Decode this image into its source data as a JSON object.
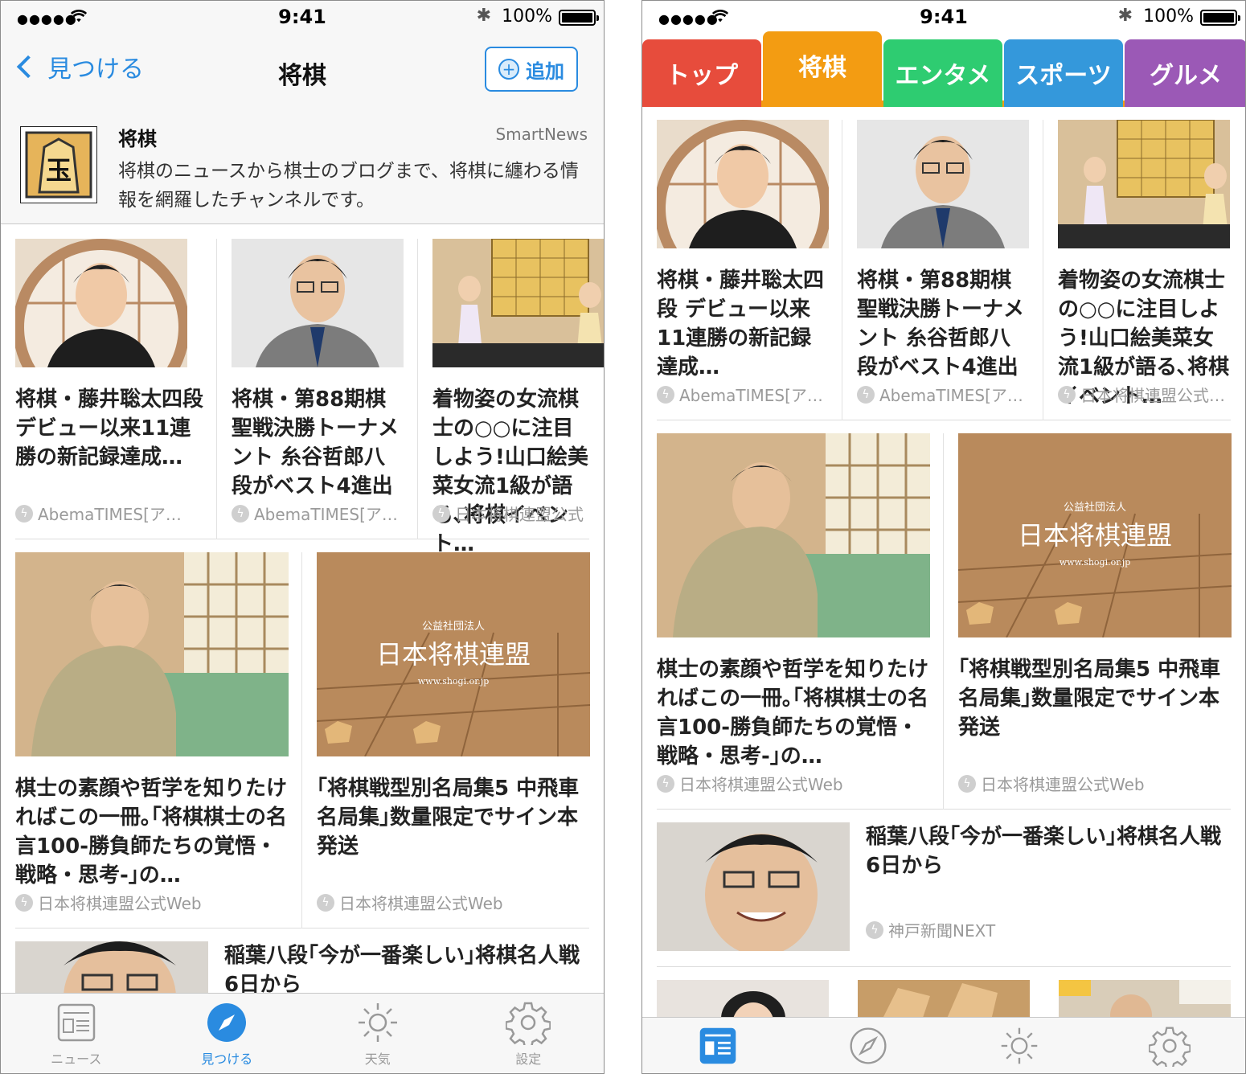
{
  "status": {
    "signal": "●●●●●",
    "time": "9:41",
    "bluetooth": "✱",
    "battery": "100%"
  },
  "left": {
    "nav": {
      "back_label": "見つける",
      "title": "将棋",
      "add_label": "追加"
    },
    "channel": {
      "name": "将棋",
      "source": "SmartNews",
      "description": "将棋のニュースから棋士のブログまで、将棋に纏わる情報を網羅したチャンネルです。",
      "logo_char": "玉"
    },
    "articles_row1": [
      {
        "title": "将棋・藤井聡太四段 デビュー以来11連勝の新記録達成…",
        "source": "AbemaTIMES[ア…"
      },
      {
        "title": "将棋・第88期棋聖戦決勝トーナメント 糸谷哲郎八段がベスト4進出",
        "source": "AbemaTIMES[ア…"
      },
      {
        "title": "着物姿の女流棋士の○○に注目しよう!山口絵美菜女流1級が語る､将棋イベント…",
        "source": "日本将棋連盟公式…"
      }
    ],
    "articles_row2": [
      {
        "title": "棋士の素顔や哲学を知りたければこの一冊｡｢将棋棋士の名言100-勝負師たちの覚悟・戦略・思考-｣の…",
        "source": "日本将棋連盟公式Web"
      },
      {
        "title": "｢将棋戦型別名局集5 中飛車名局集｣数量限定でサイン本発送",
        "source": "日本将棋連盟公式Web"
      }
    ],
    "article_wide": {
      "title": "稲葉八段｢今が一番楽しい｣将棋名人戦6日から"
    },
    "tabbar": [
      "ニュース",
      "見つける",
      "天気",
      "設定"
    ]
  },
  "right": {
    "tabs": [
      {
        "label": "トップ",
        "color": "#e74c3c"
      },
      {
        "label": "将棋",
        "color": "#f39c12"
      },
      {
        "label": "エンタメ",
        "color": "#2ecc71"
      },
      {
        "label": "スポーツ",
        "color": "#3498db"
      },
      {
        "label": "グルメ",
        "color": "#9b59b6"
      }
    ],
    "articles_row1": [
      {
        "title": "将棋・藤井聡太四段 デビュー以来11連勝の新記録達成…",
        "source": "AbemaTIMES[ア…"
      },
      {
        "title": "将棋・第88期棋聖戦決勝トーナメント 糸谷哲郎八段がベスト4進出",
        "source": "AbemaTIMES[ア…"
      },
      {
        "title": "着物姿の女流棋士の○○に注目しよう!山口絵美菜女流1級が語る､将棋イベント…",
        "source": "日本将棋連盟公式…"
      }
    ],
    "articles_row2": [
      {
        "title": "棋士の素顔や哲学を知りたければこの一冊｡｢将棋棋士の名言100-勝負師たちの覚悟・戦略・思考-｣の…",
        "source": "日本将棋連盟公式Web"
      },
      {
        "title": "｢将棋戦型別名局集5 中飛車名局集｣数量限定でサイン本発送",
        "source": "日本将棋連盟公式Web"
      }
    ],
    "article_wide": {
      "title": "稲葉八段｢今が一番楽しい｣将棋名人戦6日から",
      "source": "神戸新聞NEXT"
    }
  },
  "thumb_texts": {
    "org_small": "公益社団法人",
    "org_name": "日本将棋連盟",
    "org_url": "www.shogi.or.jp"
  },
  "colors": {
    "accent": "#2a8be0",
    "shogi_orange": "#f39c12"
  }
}
